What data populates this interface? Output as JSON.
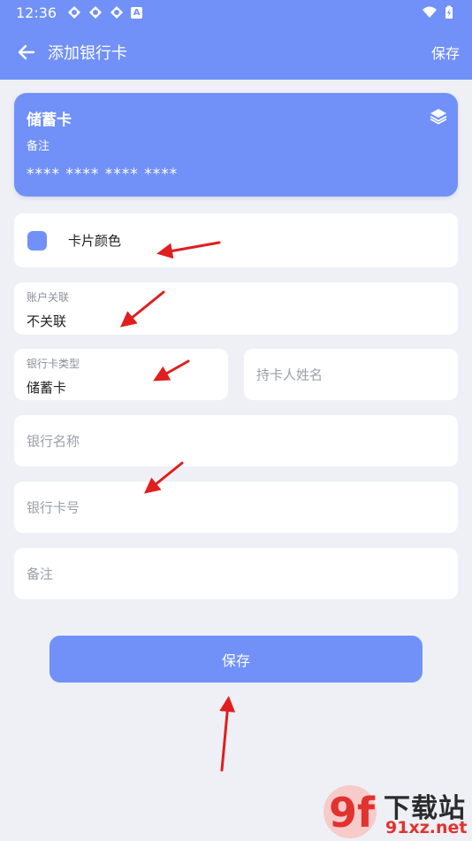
{
  "status_bar": {
    "time": "12:36",
    "app_letter": "A"
  },
  "app_bar": {
    "title": "添加银行卡",
    "save_label": "保存"
  },
  "card_preview": {
    "card_type": "储蓄卡",
    "note": "备注",
    "number": "**** **** **** ****",
    "color": "#7191f8"
  },
  "form": {
    "color_label": "卡片颜色",
    "account": {
      "label": "账户关联",
      "value": "不关联"
    },
    "card_type": {
      "label": "银行卡类型",
      "value": "储蓄卡"
    },
    "holder": {
      "placeholder": "持卡人姓名"
    },
    "bank_name": {
      "placeholder": "银行名称"
    },
    "card_number": {
      "placeholder": "银行卡号"
    },
    "remark": {
      "placeholder": "备注"
    }
  },
  "save_button": {
    "label": "保存"
  },
  "watermark": {
    "logo": "9f",
    "title": "下载站",
    "url": "91xz.net"
  },
  "colors": {
    "accent": "#7191f8",
    "background": "#eef0f6",
    "arrow": "#e01e1e"
  }
}
